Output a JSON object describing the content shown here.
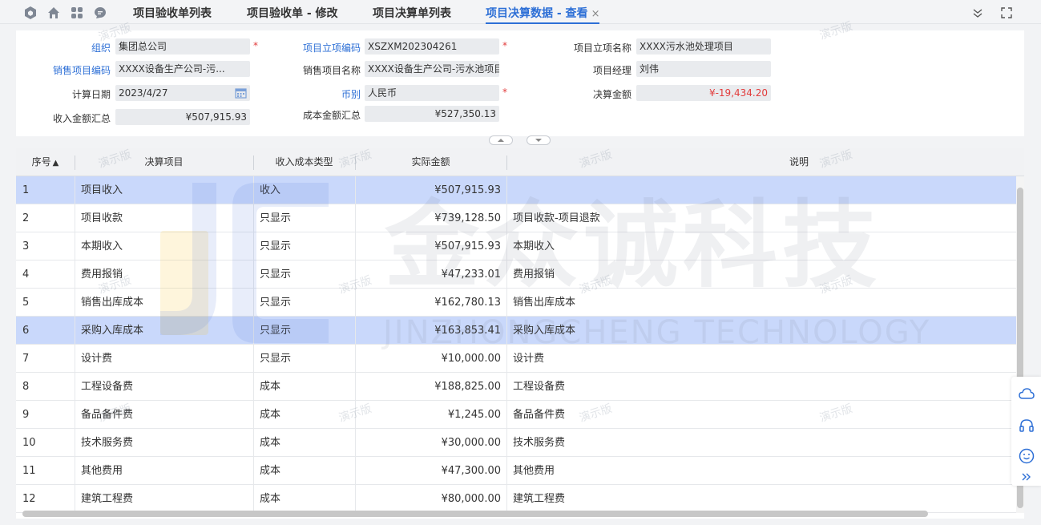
{
  "tabs": [
    {
      "label": "项目验收单列表"
    },
    {
      "label": "项目验收单 - 修改"
    },
    {
      "label": "项目决算单列表"
    },
    {
      "label": "项目决算数据 - 查看"
    }
  ],
  "tab_close": "×",
  "form": {
    "org_label": "组织",
    "org_value": "集团总公司",
    "project_code_label": "项目立项编码",
    "project_code_value": "XSZXM202304261",
    "project_name_label": "项目立项名称",
    "project_name_value": "XXXX污水池处理项目",
    "sales_code_label": "销售项目编码",
    "sales_code_value": "XXXX设备生产公司-污...",
    "sales_name_label": "销售项目名称",
    "sales_name_value": "XXXX设备生产公司-污水池项目",
    "manager_label": "项目经理",
    "manager_value": "刘伟",
    "calc_date_label": "计算日期",
    "calc_date_value": "2023/4/27",
    "currency_label": "币别",
    "currency_value": "人民币",
    "final_amount_label": "决算金额",
    "final_amount_value": "¥-19,434.20",
    "income_total_label": "收入金额汇总",
    "income_total_value": "¥507,915.93",
    "cost_total_label": "成本金额汇总",
    "cost_total_value": "¥527,350.13",
    "required_mark": "*"
  },
  "table": {
    "headers": [
      "序号",
      "决算项目",
      "收入成本类型",
      "实际金额",
      "说明"
    ],
    "sort_indicator": "▲",
    "rows": [
      {
        "no": "1",
        "item": "项目收入",
        "type": "收入",
        "amount": "¥507,915.93",
        "note": ""
      },
      {
        "no": "2",
        "item": "项目收款",
        "type": "只显示",
        "amount": "¥739,128.50",
        "note": "项目收款-项目退款"
      },
      {
        "no": "3",
        "item": "本期收入",
        "type": "只显示",
        "amount": "¥507,915.93",
        "note": "本期收入"
      },
      {
        "no": "4",
        "item": "费用报销",
        "type": "只显示",
        "amount": "¥47,233.01",
        "note": "费用报销"
      },
      {
        "no": "5",
        "item": "销售出库成本",
        "type": "只显示",
        "amount": "¥162,780.13",
        "note": "销售出库成本"
      },
      {
        "no": "6",
        "item": "采购入库成本",
        "type": "只显示",
        "amount": "¥163,853.41",
        "note": "采购入库成本"
      },
      {
        "no": "7",
        "item": "设计费",
        "type": "只显示",
        "amount": "¥10,000.00",
        "note": "设计费"
      },
      {
        "no": "8",
        "item": "工程设备费",
        "type": "成本",
        "amount": "¥188,825.00",
        "note": "工程设备费"
      },
      {
        "no": "9",
        "item": "备品备件费",
        "type": "成本",
        "amount": "¥1,245.00",
        "note": "备品备件费"
      },
      {
        "no": "10",
        "item": "技术服务费",
        "type": "成本",
        "amount": "¥30,000.00",
        "note": "技术服务费"
      },
      {
        "no": "11",
        "item": "其他费用",
        "type": "成本",
        "amount": "¥47,300.00",
        "note": "其他费用"
      },
      {
        "no": "12",
        "item": "建筑工程费",
        "type": "成本",
        "amount": "¥80,000.00",
        "note": "建筑工程费"
      }
    ]
  },
  "watermark": {
    "brand": "金众诚科技",
    "brand_en": "JINZHONGCHENG TECHNOLOGY",
    "demo": "演示版"
  },
  "colors": {
    "accent": "#2d6fd6",
    "selected_row": "#c9d8fb",
    "negative": "#e23c3c"
  }
}
